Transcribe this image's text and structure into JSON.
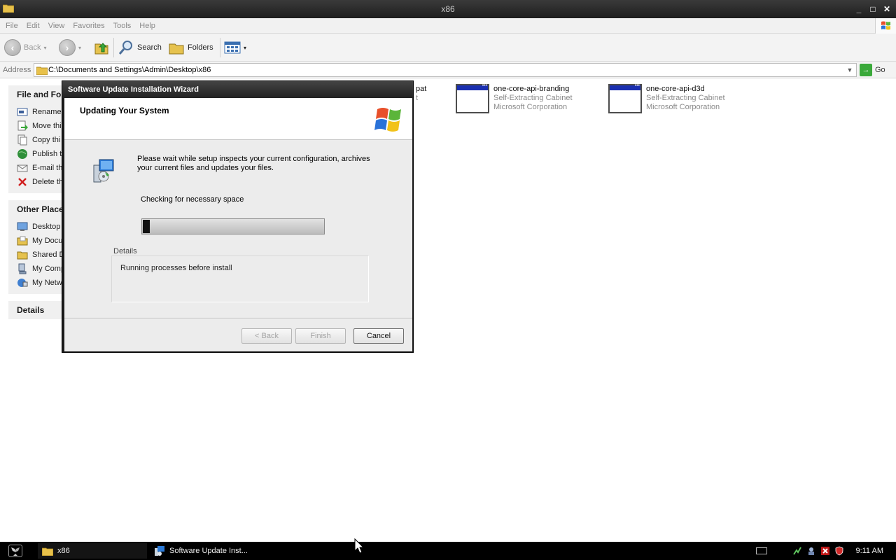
{
  "explorer": {
    "title": "x86",
    "menus": [
      "File",
      "Edit",
      "View",
      "Favorites",
      "Tools",
      "Help"
    ],
    "toolbar": {
      "back": "Back",
      "search": "Search",
      "folders": "Folders"
    },
    "address": {
      "label": "Address",
      "path": "C:\\Documents and Settings\\Admin\\Desktop\\x86",
      "go": "Go"
    },
    "taskpane": {
      "file_tasks": {
        "heading": "File and Fol",
        "items": [
          "Rename",
          "Move thi",
          "Copy thi",
          "Publish t",
          "E-mail th",
          "Delete th"
        ]
      },
      "other_places": {
        "heading": "Other Place",
        "items": [
          "Desktop",
          "My Docu",
          "Shared D",
          "My Comp",
          "My Netw"
        ]
      },
      "details": {
        "heading": "Details"
      }
    },
    "files": [
      {
        "name": "pat",
        "type": "t",
        "company": ""
      },
      {
        "name": "one-core-api-branding",
        "type": "Self-Extracting Cabinet",
        "company": "Microsoft Corporation"
      },
      {
        "name": "one-core-api-d3d",
        "type": "Self-Extracting Cabinet",
        "company": "Microsoft Corporation"
      }
    ]
  },
  "wizard": {
    "title": "Software Update Installation Wizard",
    "heading": "Updating Your System",
    "message": "Please wait while setup inspects your current configuration, archives your current files and updates your files.",
    "status": "Checking for necessary space",
    "progress": 0.04,
    "details_label": "Details",
    "details_text": "Running processes before install",
    "buttons": {
      "back": "< Back",
      "finish": "Finish",
      "cancel": "Cancel"
    }
  },
  "taskbar": {
    "tasks": [
      {
        "label": "x86"
      },
      {
        "label": "Software Update Inst..."
      }
    ],
    "clock": "9:11 AM"
  }
}
